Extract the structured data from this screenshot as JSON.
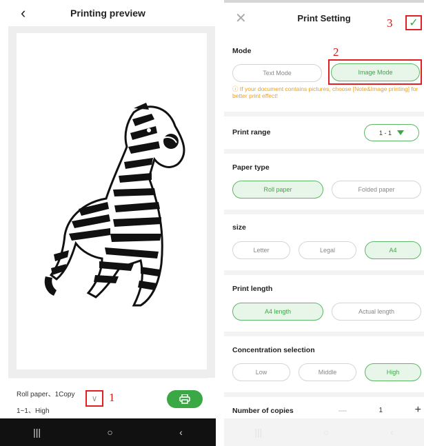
{
  "preview": {
    "title": "Printing preview",
    "back_icon": "‹",
    "summary_line1": "Roll paper、1Copy",
    "summary_line2": "1~1、High",
    "expand_icon": "∨",
    "marker_1": "1",
    "print_button_icon": "printer-icon",
    "nav": [
      "|||",
      "○",
      "‹"
    ]
  },
  "settings": {
    "title": "Print Setting",
    "close_icon": "✕",
    "confirm_icon": "✓",
    "marker_2": "2",
    "marker_3": "3",
    "mode": {
      "label": "Mode",
      "options": [
        "Text Mode",
        "Image Mode"
      ],
      "selected": "Image Mode",
      "hint": "ⓘ If your document contains pictures, choose [Note&Image printing] for better print effect!"
    },
    "print_range": {
      "label": "Print range",
      "value": "1 - 1"
    },
    "paper_type": {
      "label": "Paper type",
      "options": [
        "Roll paper",
        "Folded paper"
      ],
      "selected": "Roll paper"
    },
    "size": {
      "label": "size",
      "options": [
        "Letter",
        "Legal",
        "A4"
      ],
      "selected": "A4"
    },
    "print_length": {
      "label": "Print length",
      "options": [
        "A4 length",
        "Actual length"
      ],
      "selected": "A4 length"
    },
    "concentration": {
      "label": "Concentration selection",
      "options": [
        "Low",
        "Middle",
        "High"
      ],
      "selected": "High"
    },
    "copies": {
      "label": "Number of copies",
      "minus": "—",
      "value": "1",
      "plus": "+"
    },
    "nav": [
      "|||",
      "○",
      "‹"
    ]
  },
  "colors": {
    "accent": "#3aa845",
    "highlight_box": "#e02020",
    "hint": "#e8a020"
  }
}
